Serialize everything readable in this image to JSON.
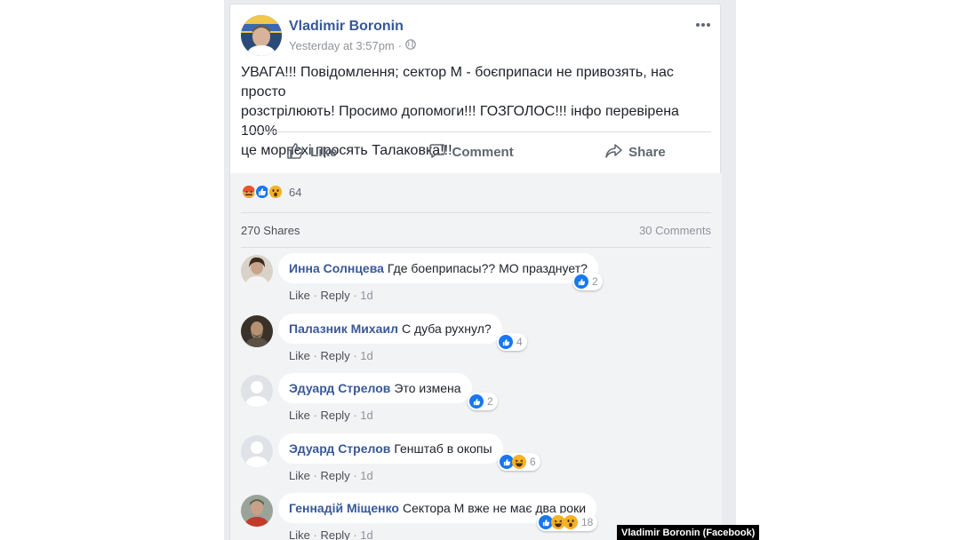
{
  "post": {
    "author": "Vladimir Boronin",
    "timestamp": "Yesterday at 3:57pm",
    "separator": "·",
    "more_icon": "more-horizontal-icon",
    "text_lines": [
      "УВАГА!!! Повідомлення; сектор М - боєприпаси не привозять, нас просто",
      "розстрілюють! Просимо допомоги!!! ГОЗГОЛОС!!! інфо перевірена 100%",
      "це морпєхі просять Талаковка!!!"
    ],
    "actions": {
      "like": "Like",
      "comment": "Comment",
      "share": "Share"
    },
    "reactions_count": "64",
    "reaction_types": [
      "angry",
      "like",
      "wow"
    ],
    "shares": "270 Shares",
    "comments_count": "30 Comments"
  },
  "comments": [
    {
      "name": "Инна Солнцева",
      "text": "Где боеприпасы?? МО празднует?",
      "reaction_count": "2",
      "reaction_types": [
        "like"
      ],
      "like": "Like",
      "reply": "Reply",
      "time": "1d",
      "sep": "·"
    },
    {
      "name": "Палазник Михаил",
      "text": "С дуба рухнул?",
      "reaction_count": "4",
      "reaction_types": [
        "like"
      ],
      "like": "Like",
      "reply": "Reply",
      "time": "1d",
      "sep": "·"
    },
    {
      "name": "Эдуард Стрелов",
      "text": "Это измена",
      "reaction_count": "2",
      "reaction_types": [
        "like"
      ],
      "like": "Like",
      "reply": "Reply",
      "time": "1d",
      "sep": "·"
    },
    {
      "name": "Эдуард Стрелов",
      "text": "Генштаб в окопы",
      "reaction_count": "6",
      "reaction_types": [
        "like",
        "haha"
      ],
      "like": "Like",
      "reply": "Reply",
      "time": "1d",
      "sep": "·"
    },
    {
      "name": "Геннадій Міщенко",
      "text": "Сектора М вже не має два роки",
      "reaction_count": "18",
      "reaction_types": [
        "like",
        "haha",
        "wow"
      ],
      "like": "Like",
      "reply": "Reply",
      "time": "1d",
      "sep": "·"
    }
  ],
  "caption": "Vladimir Boronin (Facebook)",
  "colors": {
    "link": "#365899",
    "like_blue": "#1877f2",
    "reaction_yellow": "#f7b125",
    "angry_red": "#e9710f",
    "feed_bg": "#e9ebee"
  }
}
